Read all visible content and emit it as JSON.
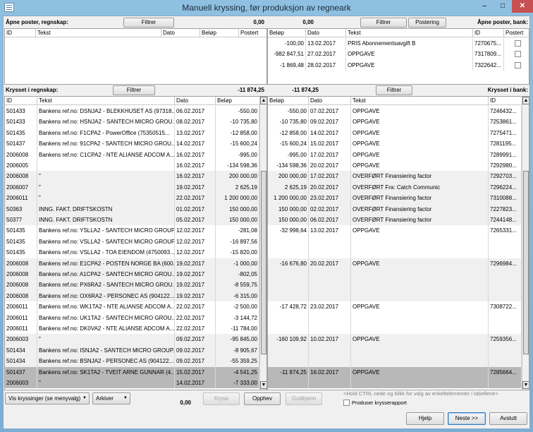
{
  "window": {
    "title": "Manuell kryssing, før produksjon av regneark",
    "min": "–",
    "max": "□",
    "close": "✕"
  },
  "top": {
    "left_label": "Åpne poster, regnskap:",
    "left_filter": "Filtrer",
    "sum_left": "0,00",
    "sum_right": "0,00",
    "right_filter": "Filtrer",
    "posting_button": "Postering",
    "right_label": "Åpne poster, bank:",
    "left_grid": {
      "columns": [
        "ID",
        "Tekst",
        "Dato",
        "Beløp",
        "Postert"
      ]
    },
    "right_grid": {
      "columns": [
        "Beløp",
        "Dato",
        "Tekst",
        "ID",
        "Postert"
      ],
      "rows": [
        {
          "belop": "-100,00",
          "dato": "13.02.2017",
          "tekst": "PRIS    Abonnementsavgift B",
          "id": "7270675..."
        },
        {
          "belop": "-982 847,51",
          "dato": "27.02.2017",
          "tekst": "OPPGAVE",
          "id": "7317809..."
        },
        {
          "belop": "-1 869,48",
          "dato": "28.02.2017",
          "tekst": "OPPGAVE",
          "id": "7322642..."
        }
      ]
    }
  },
  "middle": {
    "left_label": "Krysset i regnskap:",
    "left_filter": "Filtrer",
    "sum_left": "-11 874,25",
    "sum_right": "-11 874,25",
    "right_filter": "Filtrer",
    "right_label": "Krysset i bank:"
  },
  "left_grid": {
    "columns": [
      "ID",
      "Tekst",
      "Dato",
      "Beløp"
    ],
    "rows": [
      {
        "id": "501433",
        "tekst": "Bankens ref.no: DSNJA2 - BLEKKHUSET AS (97318...",
        "dato": "06.02.2017",
        "belop": "-550,00"
      },
      {
        "id": "501433",
        "tekst": "Bankens ref.no: HSNJA2 - SANTECH MICRO GROU...",
        "dato": "08.02.2017",
        "belop": "-10 735,80"
      },
      {
        "id": "501435",
        "tekst": "Bankens ref.no: F1CPA2 - PowerOffice (75350515...",
        "dato": "13.02.2017",
        "belop": "-12 858,00"
      },
      {
        "id": "501437",
        "tekst": "Bankens ref.no: 91CPA2 - SANTECH MICRO GROU...",
        "dato": "14.02.2017",
        "belop": "-15 600,24"
      },
      {
        "id": "2006008",
        "tekst": "Bankens ref.no: C1CPA2 - NTE ALIANSE ADCOM A...",
        "dato": "16.02.2017",
        "belop": "-995,00"
      },
      {
        "id": "2006005",
        "tekst": "",
        "dato": "16.02.2017",
        "belop": "-134 598,36"
      },
      {
        "id": "2006008",
        "tekst": "\"",
        "dato": "16.02.2017",
        "belop": "200 000,00"
      },
      {
        "id": "2006007",
        "tekst": "\"",
        "dato": "19.02.2017",
        "belop": "2 625,19"
      },
      {
        "id": "2006011",
        "tekst": "\"",
        "dato": "22.02.2017",
        "belop": "1 200 000,00"
      },
      {
        "id": "50363",
        "tekst": "INNG. FAKT. DRIFTSKOSTN",
        "dato": "01.02.2017",
        "belop": "150 000,00"
      },
      {
        "id": "50377",
        "tekst": "INNG. FAKT. DRIFTSKOSTN",
        "dato": "05.02.2017",
        "belop": "150 000,00"
      },
      {
        "id": "501435",
        "tekst": "Bankens ref.no: YSLLA2 - SANTECH MICRO GROUP...",
        "dato": "12.02.2017",
        "belop": "-281,08"
      },
      {
        "id": "501435",
        "tekst": "Bankens ref.no: VSLLA2 - SANTECH MICRO GROUP...",
        "dato": "12.02.2017",
        "belop": "-16 897,56"
      },
      {
        "id": "501435",
        "tekst": "Bankens ref.no: VSLLA2 - TOA EIENDOM (4750093...",
        "dato": "12.02.2017",
        "belop": "-15 820,00"
      },
      {
        "id": "2006008",
        "tekst": "Bankens ref.no: E1CPA2 - POSTEN NORGE BA (600...",
        "dato": "19.02.2017",
        "belop": "-1 000,00"
      },
      {
        "id": "2006008",
        "tekst": "Bankens ref.no: A1CPA2 - SANTECH MICRO GROU...",
        "dato": "19.02.2017",
        "belop": "-802,05"
      },
      {
        "id": "2006008",
        "tekst": "Bankens ref.no: PX6RA2 - SANTECH MICRO GROU...",
        "dato": "19.02.2017",
        "belop": "-8 559,75"
      },
      {
        "id": "2006008",
        "tekst": "Bankens ref.no: OX6RA2 - PERSONEC AS (904122...",
        "dato": "19.02.2017",
        "belop": "-6 315,00"
      },
      {
        "id": "2006011",
        "tekst": "Bankens ref.no: WK1TA2 - NTE ALIANSE ADCOM A...",
        "dato": "22.02.2017",
        "belop": "-2 500,00"
      },
      {
        "id": "2006011",
        "tekst": "Bankens ref.no: UK1TA2 - SANTECH MICRO GROU...",
        "dato": "22.02.2017",
        "belop": "-3 144,72"
      },
      {
        "id": "2006011",
        "tekst": "Bankens ref.no: DK0VA2 - NTE ALIANSE ADCOM A...",
        "dato": "22.02.2017",
        "belop": "-11 784,00"
      },
      {
        "id": "2006003",
        "tekst": "\"",
        "dato": "09.02.2017",
        "belop": "-95 845,00"
      },
      {
        "id": "501434",
        "tekst": "Bankens ref.no: ISNJA2 - SANTECH MICRO GROUP...",
        "dato": "09.02.2017",
        "belop": "-8 905,67"
      },
      {
        "id": "501434",
        "tekst": "Bankens ref.no: BSNJA2 - PERSONEC AS (904122...",
        "dato": "09.02.2017",
        "belop": "-55 359,25"
      },
      {
        "id": "501437",
        "tekst": "Bankens ref.no: SK1TA2 - TVEIT ARNE GUNNAR (4...",
        "dato": "15.02.2017",
        "belop": "-4 541,25"
      },
      {
        "id": "2006003",
        "tekst": "\"",
        "dato": "14.02.2017",
        "belop": "-7 333,00"
      }
    ]
  },
  "right_grid": {
    "columns": [
      "Beløp",
      "Dato",
      "Tekst",
      "ID"
    ],
    "rows": [
      {
        "belop": "-550,00",
        "dato": "07.02.2017",
        "tekst": "OPPGAVE",
        "id": "7246432..."
      },
      {
        "belop": "-10 735,80",
        "dato": "09.02.2017",
        "tekst": "OPPGAVE",
        "id": "7253861..."
      },
      {
        "belop": "-12 858,00",
        "dato": "14.02.2017",
        "tekst": "OPPGAVE",
        "id": "7275471..."
      },
      {
        "belop": "-15 600,24",
        "dato": "15.02.2017",
        "tekst": "OPPGAVE",
        "id": "7281195..."
      },
      {
        "belop": "-995,00",
        "dato": "17.02.2017",
        "tekst": "OPPGAVE",
        "id": "7289991..."
      },
      {
        "belop": "-134 598,36",
        "dato": "20.02.2017",
        "tekst": "OPPGAVE",
        "id": "7292980..."
      },
      {
        "belop": "200 000,00",
        "dato": "17.02.2017",
        "tekst": "OVERFØRT Finansiering factor",
        "id": "7292703..."
      },
      {
        "belop": "2 625,19",
        "dato": "20.02.2017",
        "tekst": "OVERFØRT Fra: Catch Communic",
        "id": "7296224..."
      },
      {
        "belop": "1 200 000,00",
        "dato": "23.02.2017",
        "tekst": "OVERFØRT Finansiering factor",
        "id": "7310088..."
      },
      {
        "belop": "150 000,00",
        "dato": "02.02.2017",
        "tekst": "OVERFØRT Finansiering factor",
        "id": "7227823..."
      },
      {
        "belop": "150 000,00",
        "dato": "06.02.2017",
        "tekst": "OVERFØRT Finansiering factor",
        "id": "7244148..."
      },
      {
        "belop": "-32 998,64",
        "dato": "13.02.2017",
        "tekst": "OPPGAVE",
        "id": "7265331..."
      },
      {
        "belop": "",
        "dato": "",
        "tekst": "",
        "id": ""
      },
      {
        "belop": "",
        "dato": "",
        "tekst": "",
        "id": ""
      },
      {
        "belop": "-16 676,80",
        "dato": "20.02.2017",
        "tekst": "OPPGAVE",
        "id": "7296984..."
      },
      {
        "belop": "",
        "dato": "",
        "tekst": "",
        "id": ""
      },
      {
        "belop": "",
        "dato": "",
        "tekst": "",
        "id": ""
      },
      {
        "belop": "",
        "dato": "",
        "tekst": "",
        "id": ""
      },
      {
        "belop": "-17 428,72",
        "dato": "23.02.2017",
        "tekst": "OPPGAVE",
        "id": "7308722..."
      },
      {
        "belop": "",
        "dato": "",
        "tekst": "",
        "id": ""
      },
      {
        "belop": "",
        "dato": "",
        "tekst": "",
        "id": ""
      },
      {
        "belop": "-160 109,92",
        "dato": "10.02.2017",
        "tekst": "OPPGAVE",
        "id": "7259356..."
      },
      {
        "belop": "",
        "dato": "",
        "tekst": "",
        "id": ""
      },
      {
        "belop": "",
        "dato": "",
        "tekst": "",
        "id": ""
      },
      {
        "belop": "-11 874,25",
        "dato": "16.02.2017",
        "tekst": "OPPGAVE",
        "id": "7285664..."
      },
      {
        "belop": "",
        "dato": "",
        "tekst": "",
        "id": ""
      }
    ]
  },
  "bottom": {
    "view_combo": "Vis kryssinger (se menyvalg)",
    "archive_combo": "Arkiver",
    "sum": "0,00",
    "kryss": "Kryss",
    "opphev": "Opphev",
    "godkjenn": "Godkjenn",
    "hint": "<Hold CTRL nede og klikk for valg av enkeltelementer i tabellene>",
    "report_checkbox": "Produser krysserapport",
    "help": "Hjelp",
    "next": "Neste >>",
    "exit": "Avslutt"
  }
}
